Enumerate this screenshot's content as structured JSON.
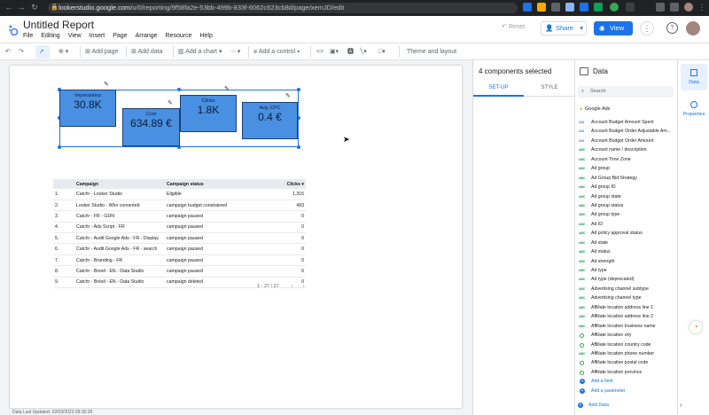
{
  "browser": {
    "url_host": "lookerstudio.google.com",
    "url_path": "/u/0/reporting/9f58fa2e-53bb-499b-833f-6062c623cb8d/page/xemJD/edit"
  },
  "app": {
    "title": "Untitled Report",
    "menus": [
      "File",
      "Editing",
      "View",
      "Insert",
      "Page",
      "Arrange",
      "Resource",
      "Help"
    ],
    "reset_label": "Reset",
    "share_label": "Share",
    "view_label": "View"
  },
  "toolbar": {
    "add_page": "Add page",
    "add_data": "Add data",
    "add_chart": "Add a chart",
    "add_control": "Add a control",
    "theme": "Theme and layout"
  },
  "scorecards": [
    {
      "label": "Impressions",
      "value": "30.8K"
    },
    {
      "label": "Cost",
      "value": "634.89 €"
    },
    {
      "label": "Clicks",
      "value": "1.8K"
    },
    {
      "label": "Avg. CPC",
      "value": "0.4 €"
    }
  ],
  "table": {
    "headers": [
      "Campaign",
      "Campaign status",
      "Clicks ▾"
    ],
    "rows": [
      {
        "n": "1.",
        "campaign": "Catchr - Looker Studio",
        "status": "Eligible",
        "clicks": "1,315"
      },
      {
        "n": "2.",
        "campaign": "Looker Studio - Who converted",
        "status": "campaign budget constrained",
        "clicks": "493"
      },
      {
        "n": "3.",
        "campaign": "Catchr - FR - GDN",
        "status": "campaign paused",
        "clicks": "0"
      },
      {
        "n": "4.",
        "campaign": "Catchr - Ads Script - FR",
        "status": "campaign paused",
        "clicks": "0"
      },
      {
        "n": "5.",
        "campaign": "Catchr - Audit Google Ads - FR - Display",
        "status": "campaign paused",
        "clicks": "0"
      },
      {
        "n": "6.",
        "campaign": "Catchr - Audit Google Ads - FR - search",
        "status": "campaign paused",
        "clicks": "0"
      },
      {
        "n": "7.",
        "campaign": "Catchr - Branding - FR",
        "status": "campaign paused",
        "clicks": "0"
      },
      {
        "n": "8.",
        "campaign": "Catchr - Bresil - EN - Data Studio",
        "status": "campaign paused",
        "clicks": "0"
      },
      {
        "n": "9.",
        "campaign": "Catchr - Brésil - EN - Data Studio",
        "status": "campaign deleted",
        "clicks": "0"
      }
    ],
    "pager": "1 - 27 / 27"
  },
  "footer": "Data Last Updated: 22/03/2023 09:30:35",
  "setup_panel": {
    "header": "4 components selected",
    "tab_setup": "SET-UP",
    "tab_style": "STYLE"
  },
  "data_panel": {
    "title": "Data",
    "search_placeholder": "Search",
    "source": "Google Ads",
    "fields": [
      {
        "type": "123",
        "name": "Account Budget Amount Spent"
      },
      {
        "type": "123",
        "name": "Account Budget Order Adjustable Am..."
      },
      {
        "type": "123",
        "name": "Account Budget Order Amount"
      },
      {
        "type": "ABC",
        "name": "Account name / description"
      },
      {
        "type": "ABC",
        "name": "Account Time Zone"
      },
      {
        "type": "ABC",
        "name": "Ad group"
      },
      {
        "type": "ABC",
        "name": "Ad Group Bid Strategy"
      },
      {
        "type": "ABC",
        "name": "Ad group ID"
      },
      {
        "type": "ABC",
        "name": "Ad group state"
      },
      {
        "type": "ABC",
        "name": "Ad group status"
      },
      {
        "type": "ABC",
        "name": "Ad group type"
      },
      {
        "type": "ABC",
        "name": "Ad ID"
      },
      {
        "type": "ABC",
        "name": "Ad policy approval status"
      },
      {
        "type": "ABC",
        "name": "Ad state"
      },
      {
        "type": "ABC",
        "name": "Ad status"
      },
      {
        "type": "ABC",
        "name": "Ad strength"
      },
      {
        "type": "ABC",
        "name": "Ad type"
      },
      {
        "type": "ABC",
        "name": "Ad type (deprecated)"
      },
      {
        "type": "ABC",
        "name": "Advertising channel subtype"
      },
      {
        "type": "ABC",
        "name": "Advertising channel type"
      },
      {
        "type": "ABC",
        "name": "Affiliate location address line 1"
      },
      {
        "type": "ABC",
        "name": "Affiliate location address line 2"
      },
      {
        "type": "ABC",
        "name": "Affiliate location business name"
      },
      {
        "type": "GEO",
        "name": "Affiliate location city"
      },
      {
        "type": "GEO",
        "name": "Affiliate location country code"
      },
      {
        "type": "ABC",
        "name": "Affiliate location phone number"
      },
      {
        "type": "GEO",
        "name": "Affiliate location postal code"
      },
      {
        "type": "GEO",
        "name": "Affiliate location province"
      }
    ],
    "add_field": "Add a field",
    "add_parameter": "Add a parameter",
    "add_data": "Add Data"
  },
  "rail": {
    "data": "Data",
    "properties": "Properties"
  }
}
